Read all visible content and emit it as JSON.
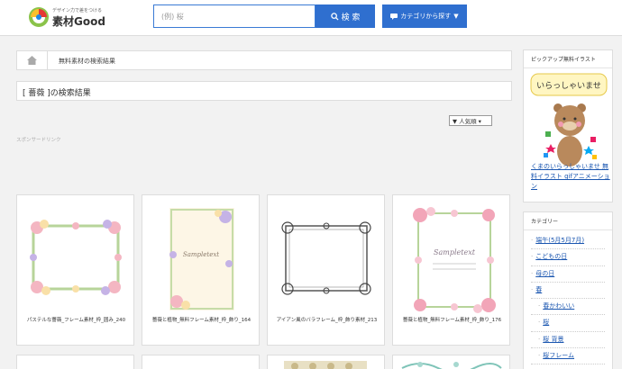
{
  "header": {
    "logo_tagline": "デザイン力で差をつける",
    "logo_name": "素材Good",
    "search_placeholder": "(例) 桜",
    "search_button": "検 索",
    "category_button": "カテゴリから探す"
  },
  "breadcrumb": {
    "current": "無料素材の検索結果"
  },
  "results": {
    "title": "[ 薔薇 ]の検索結果",
    "sort": "▼ 人気順 ▾",
    "sponsor_label": "スポンサードリンク",
    "items": [
      {
        "label": "パステルな薔薇_フレーム素材_枠_囲み_240"
      },
      {
        "label": "薔薇と植物_無料フレーム素材_枠_飾り_164"
      },
      {
        "label": "アイアン風のバラフレーム_枠_飾り素材_213"
      },
      {
        "label": "薔薇と植物_無料フレーム素材_枠_飾り_176"
      }
    ],
    "sample_text": "Sampletext"
  },
  "sidebar": {
    "pickup": {
      "heading": "ピックアップ無料イラスト",
      "image_text": "いらっしゃいませ",
      "link": "くまのいらっしゃいませ 無料イラスト gifアニメーション"
    },
    "categories": {
      "heading": "カテゴリー",
      "items": [
        {
          "label": "端午(5月5月7月)",
          "level": 1
        },
        {
          "label": "こどもの日",
          "level": 1
        },
        {
          "label": "母の日",
          "level": 1
        },
        {
          "label": "春",
          "level": 1
        },
        {
          "label": "春かわいい",
          "level": 2
        },
        {
          "label": "桜",
          "level": 2
        },
        {
          "label": "桜 背景",
          "level": 2
        },
        {
          "label": "桜フレーム",
          "level": 2
        }
      ]
    }
  },
  "colors": {
    "accent_blue": "#2f6fcf",
    "link_blue": "#1a56b0",
    "page_bg": "#f2f2f2"
  }
}
